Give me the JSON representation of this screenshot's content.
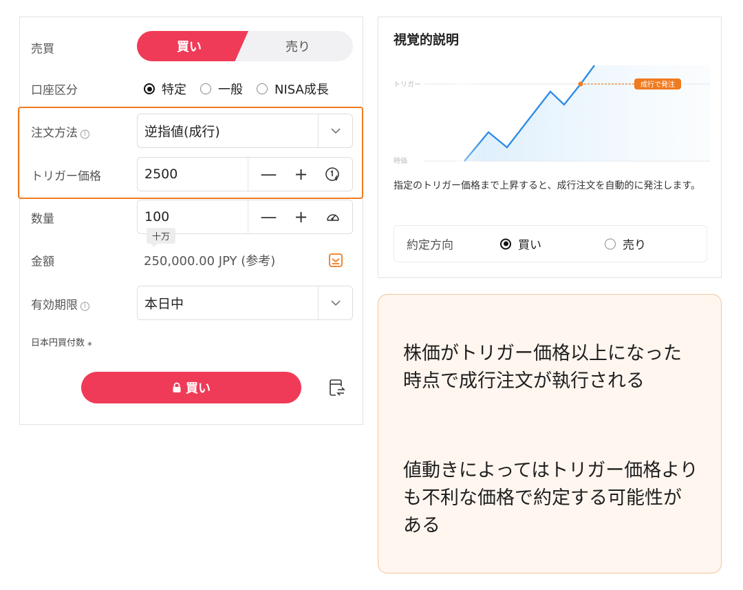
{
  "order_form": {
    "side": {
      "label": "売買",
      "buy": "買い",
      "sell": "売り"
    },
    "account": {
      "label": "口座区分",
      "options": [
        "特定",
        "一般",
        "NISA成長"
      ],
      "selected": "特定"
    },
    "order_type": {
      "label": "注文方法",
      "value": "逆指値(成行)"
    },
    "trigger_price": {
      "label": "トリガー価格",
      "value": "2500"
    },
    "quantity": {
      "label": "数量",
      "value": "100",
      "tooltip": "十万"
    },
    "amount": {
      "label": "金額",
      "value": "250,000.00 JPY (参考)"
    },
    "expiry": {
      "label": "有効期限",
      "value": "本日中"
    },
    "jpy_shares_label": "日本円買付数 ⁎",
    "submit_label": "買い"
  },
  "visual_explanation": {
    "title": "視覚的説明",
    "chart": {
      "trigger_label": "トリガー",
      "time_label": "時価",
      "badge": "成行で発注"
    },
    "description": "指定のトリガー価格まで上昇すると、成行注文を自動的に発注します。",
    "direction": {
      "label": "約定方向",
      "options": [
        "買い",
        "売り"
      ],
      "selected": "買い"
    }
  },
  "note": {
    "paragraph1": "株価がトリガー価格以上になった時点で成行注文が執行される",
    "paragraph2": "値動きによってはトリガー価格よりも不利な価格で約定する可能性がある"
  },
  "colors": {
    "accent": "#ef3b58",
    "highlight": "#f07a1f",
    "chart_line": "#2d8ce6",
    "note_bg": "#fff6ef",
    "note_border": "#f2c49a"
  }
}
